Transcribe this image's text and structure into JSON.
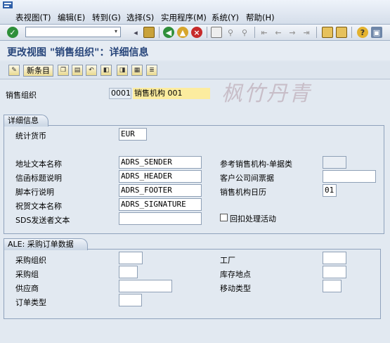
{
  "menu": {
    "items": [
      "表视图(T)",
      "编辑(E)",
      "转到(G)",
      "选择(S)",
      "实用程序(M)",
      "系统(Y)",
      "帮助(H)"
    ]
  },
  "toolbar": {
    "icons": [
      "check-icon",
      "dropdown-icon",
      "back-arrow-icon",
      "save-icon",
      "back-icon",
      "exit-icon",
      "cancel-icon",
      "print-icon",
      "find-icon",
      "find-next-icon",
      "first-page-icon",
      "previous-page-icon",
      "next-page-icon",
      "last-page-icon",
      "create-session-icon",
      "shortcut-icon",
      "help-icon",
      "customize-icon"
    ]
  },
  "title": "更改视图 \"销售组织\"：详细信息",
  "app_toolbar": {
    "new_entries": "新条目"
  },
  "header": {
    "sales_org_label": "销售组织",
    "sales_org_value": "0001",
    "sales_org_text": "销售机构 001"
  },
  "watermark": "枫竹丹青",
  "details": {
    "title": "详细信息",
    "stat_currency_label": "统计货币",
    "stat_currency_value": "EUR",
    "address_text_label": "地址文本名称",
    "address_text_value": "ADRS_SENDER",
    "letter_header_label": "信函标题说明",
    "letter_header_value": "ADRS_HEADER",
    "footer_label": "脚本行说明",
    "footer_value": "ADRS_FOOTER",
    "greeting_label": "祝贺文本名称",
    "greeting_value": "ADRS_SIGNATURE",
    "sds_sender_label": "SDS发送者文本",
    "sds_sender_value": "",
    "ref_sales_org_label": "参考销售机构-单据类",
    "ref_sales_org_value": "",
    "customer_ic_label": "客户公司间票据",
    "customer_ic_value": "",
    "calendar_label": "销售机构日历",
    "calendar_value": "01",
    "rebate_label": "回扣处理活动"
  },
  "ale": {
    "title": "ALE: 采购订单数据",
    "purch_org_label": "采购组织",
    "purch_org_value": "",
    "purch_group_label": "采购组",
    "purch_group_value": "",
    "vendor_label": "供应商",
    "vendor_value": "",
    "order_type_label": "订单类型",
    "order_type_value": "",
    "plant_label": "工厂",
    "plant_value": "",
    "storage_loc_label": "库存地点",
    "storage_loc_value": "",
    "movement_type_label": "移动类型",
    "movement_type_value": ""
  },
  "colors": {
    "title": "#27457a",
    "background": "#e2e9f1",
    "highlight": "#fcec9f"
  }
}
